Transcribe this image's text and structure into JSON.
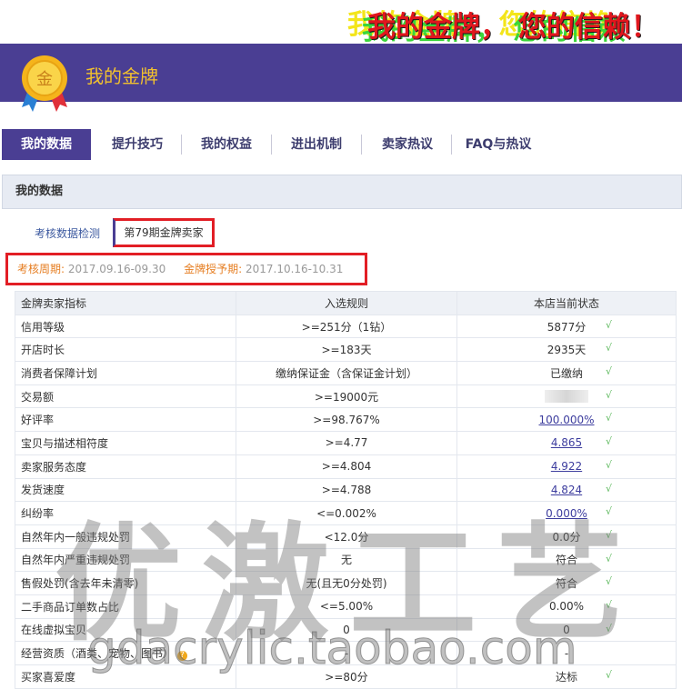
{
  "promo": {
    "ghost1": "我的金牌， 您的信赖",
    "ghost2": "我的金牌， 您的信赖",
    "main": "我的金牌， 您的信赖！"
  },
  "header": {
    "title": "我的金牌",
    "medal_text": "金",
    "accent": "#4a3e93",
    "gold": "#f2c12e"
  },
  "tabs": [
    {
      "label": "我的数据",
      "active": true
    },
    {
      "label": "提升技巧"
    },
    {
      "label": "我的权益"
    },
    {
      "label": "进出机制"
    },
    {
      "label": "卖家热议"
    },
    {
      "label": "FAQ与热议"
    }
  ],
  "section": {
    "title": "我的数据"
  },
  "subtabs": {
    "left": "考核数据检测",
    "right": "第79期金牌卖家"
  },
  "period": {
    "assess_label": "考核周期:",
    "assess_value": "2017.09.16-09.30",
    "grant_label": "金牌授予期:",
    "grant_value": "2017.10.16-10.31"
  },
  "table": {
    "headers": [
      "金牌卖家指标",
      "入选规则",
      "本店当前状态"
    ],
    "rows": [
      {
        "metric": "信用等级",
        "rule": ">=251分（1钻）",
        "status": "5877分",
        "check": "√"
      },
      {
        "metric": "开店时长",
        "rule": ">=183天",
        "status": "2935天",
        "check": "√"
      },
      {
        "metric": "消费者保障计划",
        "rule": "缴纳保证金（含保证金计划）",
        "status": "已缴纳",
        "check": "√"
      },
      {
        "metric": "交易额",
        "rule": ">=19000元",
        "status": "",
        "check": "√"
      },
      {
        "metric": "好评率",
        "rule": ">=98.767%",
        "status": "100.000%",
        "check": "√"
      },
      {
        "metric": "宝贝与描述相符度",
        "rule": ">=4.77",
        "status": "4.865",
        "check": "√"
      },
      {
        "metric": "卖家服务态度",
        "rule": ">=4.804",
        "status": "4.922",
        "check": "√"
      },
      {
        "metric": "发货速度",
        "rule": ">=4.788",
        "status": "4.824",
        "check": "√"
      },
      {
        "metric": "纠纷率",
        "rule": "<=0.002%",
        "status": "0.000%",
        "check": "√"
      },
      {
        "metric": "自然年内一般违规处罚",
        "rule": "<12.0分",
        "status": "0.0分",
        "check": "√"
      },
      {
        "metric": "自然年内严重违规处罚",
        "rule": "无",
        "status": "符合",
        "check": "√"
      },
      {
        "metric": "售假处罚(含去年未清零)",
        "rule": "无(且无0分处罚)",
        "status": "符合",
        "check": "√"
      },
      {
        "metric": "二手商品订单数占比",
        "rule": "<=5.00%",
        "status": "0.00%",
        "check": "√"
      },
      {
        "metric": "在线虚拟宝贝",
        "rule": "0",
        "status": "0",
        "check": "√"
      },
      {
        "metric": "经营资质（酒类、宠物、图书）",
        "rule": "-",
        "status": "-",
        "check": ""
      },
      {
        "metric": "买家喜爱度",
        "rule": ">=80分",
        "status": "达标",
        "check": "√"
      }
    ]
  },
  "watermark": {
    "main": "优激工艺",
    "url": "gdacrylic.taobao.com"
  }
}
